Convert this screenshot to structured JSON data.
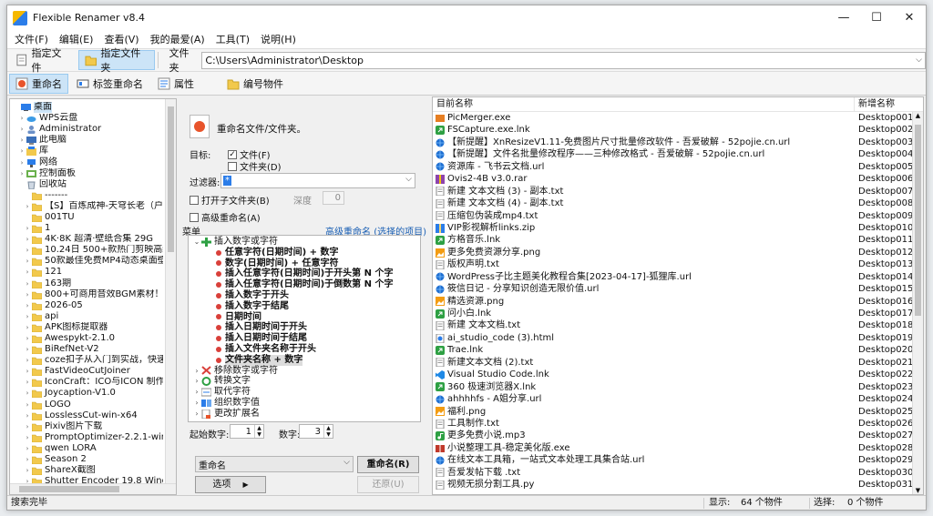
{
  "window": {
    "title": "Flexible Renamer v8.4",
    "controls": [
      "—",
      "☐",
      "✕"
    ]
  },
  "menu": [
    "文件(F)",
    "编辑(E)",
    "查看(V)",
    "我的最爱(A)",
    "工具(T)",
    "说明(H)"
  ],
  "toolbar1": {
    "file_btn": "指定文件",
    "folder_btn": "指定文件夹",
    "path_label": "文件夹",
    "path_value": "C:\\Users\\Administrator\\Desktop"
  },
  "toolbar2": {
    "rename": "重命名",
    "tag_rename": "标签重命名",
    "props": "属性",
    "numbering": "编号物件"
  },
  "tree": [
    {
      "label": "桌面",
      "icon": "desktop-icon",
      "sel": true,
      "exp": ""
    },
    {
      "label": "WPS云盘",
      "icon": "cloud-icon",
      "exp": "›"
    },
    {
      "label": "Administrator",
      "icon": "user-icon",
      "exp": "›"
    },
    {
      "label": "此电脑",
      "icon": "computer-icon",
      "exp": "›"
    },
    {
      "label": "库",
      "icon": "library-icon",
      "exp": "›"
    },
    {
      "label": "网络",
      "icon": "network-icon",
      "exp": "›"
    },
    {
      "label": "控制面板",
      "icon": "control-panel-icon",
      "exp": "›"
    },
    {
      "label": "回收站",
      "icon": "recycle-bin-icon",
      "exp": ""
    },
    {
      "label": "-------",
      "icon": "folder-icon",
      "exp": ""
    },
    {
      "label": "【S】百炼成神-天穹长老（户外美",
      "icon": "folder-icon",
      "exp": "›"
    },
    {
      "label": "001TU",
      "icon": "folder-icon",
      "exp": ""
    },
    {
      "label": "1",
      "icon": "folder-icon",
      "exp": "›"
    },
    {
      "label": "4K·8K 超清·壁纸合集 29G",
      "icon": "folder-icon",
      "exp": "›"
    },
    {
      "label": "10.24日 500+款热门剪映高级感字",
      "icon": "folder-icon",
      "exp": "›"
    },
    {
      "label": "50款最佳免费MP4动态桌面壁纸合",
      "icon": "folder-icon",
      "exp": "›"
    },
    {
      "label": "121",
      "icon": "folder-icon",
      "exp": "›"
    },
    {
      "label": "163期",
      "icon": "folder-icon",
      "exp": "›"
    },
    {
      "label": "800+可商用音效BGM素材！全中文",
      "icon": "folder-icon",
      "exp": "›"
    },
    {
      "label": "2026-05",
      "icon": "folder-icon",
      "exp": "›"
    },
    {
      "label": "api",
      "icon": "folder-icon",
      "exp": "›"
    },
    {
      "label": "APK图标提取器",
      "icon": "folder-icon",
      "exp": "›"
    },
    {
      "label": "Awespykt-2.1.0",
      "icon": "folder-icon",
      "exp": "›"
    },
    {
      "label": "BiRefNet-V2",
      "icon": "folder-icon",
      "exp": "›"
    },
    {
      "label": "coze扣子从入门到实战，快速掌握",
      "icon": "folder-icon",
      "exp": "›"
    },
    {
      "label": "FastVideoCutJoiner",
      "icon": "folder-icon",
      "exp": "›"
    },
    {
      "label": "IconCraft：ICO与ICON 制作工具",
      "icon": "folder-icon",
      "exp": "›"
    },
    {
      "label": "Joycaption-V1.0",
      "icon": "folder-icon",
      "exp": "›"
    },
    {
      "label": "LOGO",
      "icon": "folder-icon",
      "exp": "›"
    },
    {
      "label": "LosslessCut-win-x64",
      "icon": "folder-icon",
      "exp": "›"
    },
    {
      "label": "Pixiv图片下载",
      "icon": "folder-icon",
      "exp": "›"
    },
    {
      "label": "PromptOptimizer-2.2.1-win-x64",
      "icon": "folder-icon",
      "exp": "›"
    },
    {
      "label": "qwen LORA",
      "icon": "folder-icon",
      "exp": "›"
    },
    {
      "label": "Season 2",
      "icon": "folder-icon",
      "exp": "›"
    },
    {
      "label": "ShareX截图",
      "icon": "folder-icon",
      "exp": "›"
    },
    {
      "label": "Shutter Encoder 19.8 Windows",
      "icon": "folder-icon",
      "exp": "›"
    }
  ],
  "mid": {
    "heading": "重命名文件/文件夹。",
    "target_label": "目标:",
    "chk_file": "文件(F)",
    "chk_folder": "文件夹(D)",
    "filter_label": "过滤器:",
    "filter_value": "*",
    "open_subfolder": "打开子文件夹(B)",
    "depth_label": "深度",
    "depth_value": "0",
    "advanced": "高级重命名(A)",
    "menu_label": "菜单",
    "menu_link": "高级重命名 (选择的项目)",
    "start_label": "起始数字:",
    "start_value": "1",
    "num_label": "数字:",
    "num_value": "3",
    "action_combo": "重命名",
    "rename_btn": "重命名(R)",
    "options_btn": "选项",
    "restore_btn": "还原(U)"
  },
  "menu_items": [
    {
      "label": "插入数字或字符",
      "kind": "group",
      "exp": "⌄",
      "icon": "plus-icon"
    },
    {
      "label": "任意字符(日期时间) + 数字",
      "kind": "sub"
    },
    {
      "label": "数字(日期时间) + 任意字符",
      "kind": "sub"
    },
    {
      "label": "插入任意字符(日期时间)于开头第 N 个字",
      "kind": "sub"
    },
    {
      "label": "插入任意字符(日期时间)于倒数第 N 个字",
      "kind": "sub"
    },
    {
      "label": "插入数字于开头",
      "kind": "sub"
    },
    {
      "label": "插入数字于结尾",
      "kind": "sub"
    },
    {
      "label": "日期时间",
      "kind": "sub"
    },
    {
      "label": "插入日期时间于开头",
      "kind": "sub"
    },
    {
      "label": "插入日期时间于结尾",
      "kind": "sub"
    },
    {
      "label": "插入文件夹名称于开头",
      "kind": "sub"
    },
    {
      "label": "文件夹名称 + 数字",
      "kind": "sub",
      "sel": true
    },
    {
      "label": "移除数字或字符",
      "kind": "group",
      "exp": "›",
      "icon": "remove-icon"
    },
    {
      "label": "转换文字",
      "kind": "group",
      "exp": "›",
      "icon": "convert-icon"
    },
    {
      "label": "取代字符",
      "kind": "group",
      "exp": "›",
      "icon": "replace-icon"
    },
    {
      "label": "组织数字值",
      "kind": "group",
      "exp": "›",
      "icon": "organize-icon"
    },
    {
      "label": "更改扩展名",
      "kind": "group",
      "exp": "›",
      "icon": "extension-icon"
    }
  ],
  "list": {
    "col1": "目前名称",
    "col2": "新增名称",
    "rows": [
      {
        "n": "PicMerger.exe",
        "m": "Desktop001.ex",
        "i": "exe-icon"
      },
      {
        "n": "FSCapture.exe.lnk",
        "m": "Desktop002.lnl",
        "i": "shortcut-icon"
      },
      {
        "n": "【新提醒】XnResizeV1.11-免费图片尺寸批量修改软件 - 吾爱破解 - 52pojie.cn.url",
        "m": "Desktop003.ur",
        "i": "globe-icon"
      },
      {
        "n": "【新提醒】文件名批量修改程序——三种修改格式 - 吾爱破解 - 52pojie.cn.url",
        "m": "Desktop004.ur",
        "i": "globe-icon"
      },
      {
        "n": "资源库 - 飞书云文档.url",
        "m": "Desktop005.ur",
        "i": "globe-icon"
      },
      {
        "n": "Ovis2-4B v3.0.rar",
        "m": "Desktop006.ra",
        "i": "archive-icon"
      },
      {
        "n": "新建 文本文档 (3) - 副本.txt",
        "m": "Desktop007.tx",
        "i": "text-icon"
      },
      {
        "n": "新建 文本文档 (4) - 副本.txt",
        "m": "Desktop008.tx",
        "i": "text-icon"
      },
      {
        "n": "压缩包伪装成mp4.txt",
        "m": "Desktop009.tx",
        "i": "text-icon"
      },
      {
        "n": "VIP影视解析links.zip",
        "m": "Desktop010.zi",
        "i": "zip-icon"
      },
      {
        "n": "方格音乐.lnk",
        "m": "Desktop011.lnl",
        "i": "shortcut-icon"
      },
      {
        "n": "更多免费资源分享.png",
        "m": "Desktop012.pr",
        "i": "image-icon"
      },
      {
        "n": "版权声明.txt",
        "m": "Desktop013.tx",
        "i": "text-icon"
      },
      {
        "n": "WordPress子比主题美化教程合集[2023-04-17]-狐狸库.url",
        "m": "Desktop014.ur",
        "i": "globe-icon"
      },
      {
        "n": "筱信日记 - 分享知识创造无限价值.url",
        "m": "Desktop015.ur",
        "i": "globe-icon"
      },
      {
        "n": "精选资源.png",
        "m": "Desktop016.pr",
        "i": "image-icon"
      },
      {
        "n": "问小白.lnk",
        "m": "Desktop017.lnl",
        "i": "shortcut-icon"
      },
      {
        "n": "新建 文本文档.txt",
        "m": "Desktop018.tx",
        "i": "text-icon"
      },
      {
        "n": "ai_studio_code (3).html",
        "m": "Desktop019.ht",
        "i": "html-icon"
      },
      {
        "n": "Trae.lnk",
        "m": "Desktop020.lnl",
        "i": "shortcut-icon"
      },
      {
        "n": "新建文本文档 (2).txt",
        "m": "Desktop021.tx",
        "i": "text-icon"
      },
      {
        "n": "Visual Studio Code.lnk",
        "m": "Desktop022.lnl",
        "i": "vscode-icon"
      },
      {
        "n": "360 极速浏览器X.lnk",
        "m": "Desktop023.lnl",
        "i": "shortcut-icon"
      },
      {
        "n": "ahhhhfs - A姐分享.url",
        "m": "Desktop024.ur",
        "i": "globe-icon"
      },
      {
        "n": "福利.png",
        "m": "Desktop025.pr",
        "i": "image-icon"
      },
      {
        "n": "工具制作.txt",
        "m": "Desktop026.tx",
        "i": "text-icon"
      },
      {
        "n": "更多免费小说.mp3",
        "m": "Desktop027.m",
        "i": "audio-icon"
      },
      {
        "n": "小说整理工具-稳定美化版.exe",
        "m": "Desktop028.ex",
        "i": "book-icon"
      },
      {
        "n": "在线文本工具箱，一站式文本处理工具集合站.url",
        "m": "Desktop029.ur",
        "i": "globe-icon"
      },
      {
        "n": "吾爱发帖下载 .txt",
        "m": "Desktop030.tx",
        "i": "text-icon"
      },
      {
        "n": "视频无损分割工具.py",
        "m": "Desktop031.py",
        "i": "text-icon"
      }
    ]
  },
  "status": {
    "left": "搜索完毕",
    "shown_label": "显示:",
    "shown_value": "64 个物件",
    "sel_label": "选择:",
    "sel_value": "0 个物件"
  },
  "colors": {
    "folder": "#f2c94c",
    "accent": "#cce4f7",
    "link": "#1a5fb4"
  }
}
